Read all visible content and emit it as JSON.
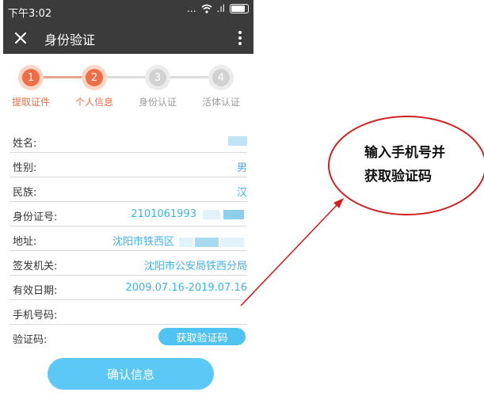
{
  "status_bar": {
    "time": "下午3:02",
    "signal_dots": "...",
    "signal_text": ".ıl"
  },
  "header": {
    "title": "身份验证",
    "close_icon": "close-icon",
    "more_icon": "more-vertical-icon"
  },
  "steps": [
    {
      "number": "1",
      "label": "提取证件",
      "state": "active"
    },
    {
      "number": "2",
      "label": "个人信息",
      "state": "active"
    },
    {
      "number": "3",
      "label": "身份认证",
      "state": "inactive"
    },
    {
      "number": "4",
      "label": "活体认证",
      "state": "inactive"
    }
  ],
  "form": {
    "rows": [
      {
        "label": "姓名:",
        "value": ""
      },
      {
        "label": "性别:",
        "value": "男"
      },
      {
        "label": "民族:",
        "value": "汉"
      },
      {
        "label": "身份证号:",
        "value": "2101061993"
      },
      {
        "label": "地址:",
        "value": "沈阳市铁西区"
      },
      {
        "label": "签发机关:",
        "value": "沈阳市公安局铁西分局"
      },
      {
        "label": "有效日期:",
        "value": "2009.07.16-2019.07.16"
      },
      {
        "label": "手机号码:",
        "value": ""
      },
      {
        "label": "验证码:",
        "value": ""
      }
    ],
    "get_code_label": "获取验证码"
  },
  "confirm_label": "确认信息",
  "annotation": {
    "line1": "输入手机号并",
    "line2": "获取验证码"
  },
  "colors": {
    "accent": "#f06e45",
    "link_blue": "#3fb3e5",
    "button_blue": "#5bc8f5",
    "annotation_red": "#d11f1f",
    "header_dark": "#3b3b3b"
  }
}
